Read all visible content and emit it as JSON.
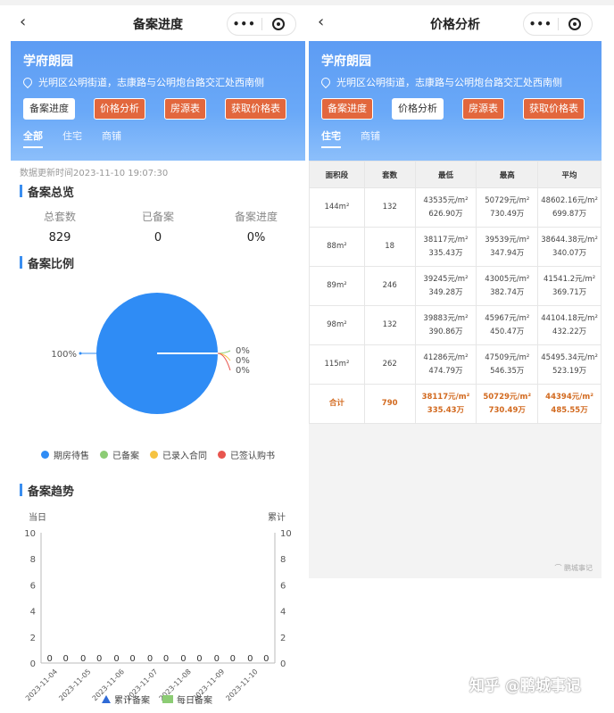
{
  "left": {
    "nav_title": "备案进度",
    "project_name": "学府朗园",
    "address": "光明区公明街道，志康路与公明炮台路交汇处西南侧",
    "buttons": [
      "备案进度",
      "价格分析",
      "房源表",
      "获取价格表"
    ],
    "tabs": [
      "全部",
      "住宅",
      "商铺"
    ],
    "update_time": "数据更新时间2023-11-10 19:07:30",
    "overview_title": "备案总览",
    "stats": [
      {
        "label": "总套数",
        "value": "829"
      },
      {
        "label": "已备案",
        "value": "0"
      },
      {
        "label": "备案进度",
        "value": "0%"
      }
    ],
    "ratio_title": "备案比例",
    "trend_title": "备案趋势"
  },
  "right": {
    "nav_title": "价格分析",
    "project_name": "学府朗园",
    "address": "光明区公明街道，志康路与公明炮台路交汇处西南侧",
    "buttons": [
      "备案进度",
      "价格分析",
      "房源表",
      "获取价格表"
    ],
    "tabs": [
      "住宅",
      "商铺"
    ],
    "table": {
      "headers": [
        "面积段",
        "套数",
        "最低",
        "最高",
        "平均"
      ],
      "rows": [
        [
          "144m²",
          "132",
          "43535元/m²",
          "626.90万",
          "50729元/m²",
          "730.49万",
          "48602.16元/m²",
          "699.87万"
        ],
        [
          "88m²",
          "18",
          "38117元/m²",
          "335.43万",
          "39539元/m²",
          "347.94万",
          "38644.38元/m²",
          "340.07万"
        ],
        [
          "89m²",
          "246",
          "39245元/m²",
          "349.28万",
          "43005元/m²",
          "382.74万",
          "41541.2元/m²",
          "369.71万"
        ],
        [
          "98m²",
          "132",
          "39883元/m²",
          "390.86万",
          "45967元/m²",
          "450.47万",
          "44104.18元/m²",
          "432.22万"
        ],
        [
          "115m²",
          "262",
          "41286元/m²",
          "474.79万",
          "47509元/m²",
          "546.35万",
          "45495.34元/m²",
          "523.19万"
        ]
      ],
      "total": [
        "合计",
        "790",
        "38117元/m²",
        "335.43万",
        "50729元/m²",
        "730.49万",
        "44394元/m²",
        "485.55万"
      ]
    },
    "watermark": "鹏城事记"
  },
  "footer_watermark": "知乎 @鹏城事记",
  "colors": {
    "accent": "#5d9cf3",
    "orange_button": "#e2673d",
    "pie_blue": "#2f8cf5"
  },
  "chart_data": [
    {
      "type": "pie",
      "title": "备案比例",
      "labels": [
        "期房待售",
        "已备案",
        "已录入合同",
        "已签认购书"
      ],
      "values": [
        100,
        0,
        0,
        0
      ],
      "value_labels": [
        "100%",
        "0%",
        "0%",
        "0%"
      ],
      "colors": [
        "#2f8cf5",
        "#8ccc74",
        "#f5c342",
        "#e8554e"
      ],
      "legend": "bottom"
    },
    {
      "type": "bar",
      "title": "备案趋势",
      "left_axis_label": "当日",
      "right_axis_label": "累计",
      "categories": [
        "2023-11-04",
        "2023-11-05",
        "2023-11-06",
        "2023-11-07",
        "2023-11-08",
        "2023-11-09",
        "2023-11-10"
      ],
      "series": [
        {
          "name": "累计备案",
          "values": [
            0,
            0,
            0,
            0,
            0,
            0,
            0
          ],
          "color": "#2f6ad6"
        },
        {
          "name": "每日备案",
          "values": [
            0,
            0,
            0,
            0,
            0,
            0,
            0
          ],
          "color": "#8ccc74"
        }
      ],
      "ylim": [
        0,
        10
      ],
      "yticks": [
        0,
        2,
        4,
        6,
        8,
        10
      ],
      "legend": "bottom"
    }
  ]
}
